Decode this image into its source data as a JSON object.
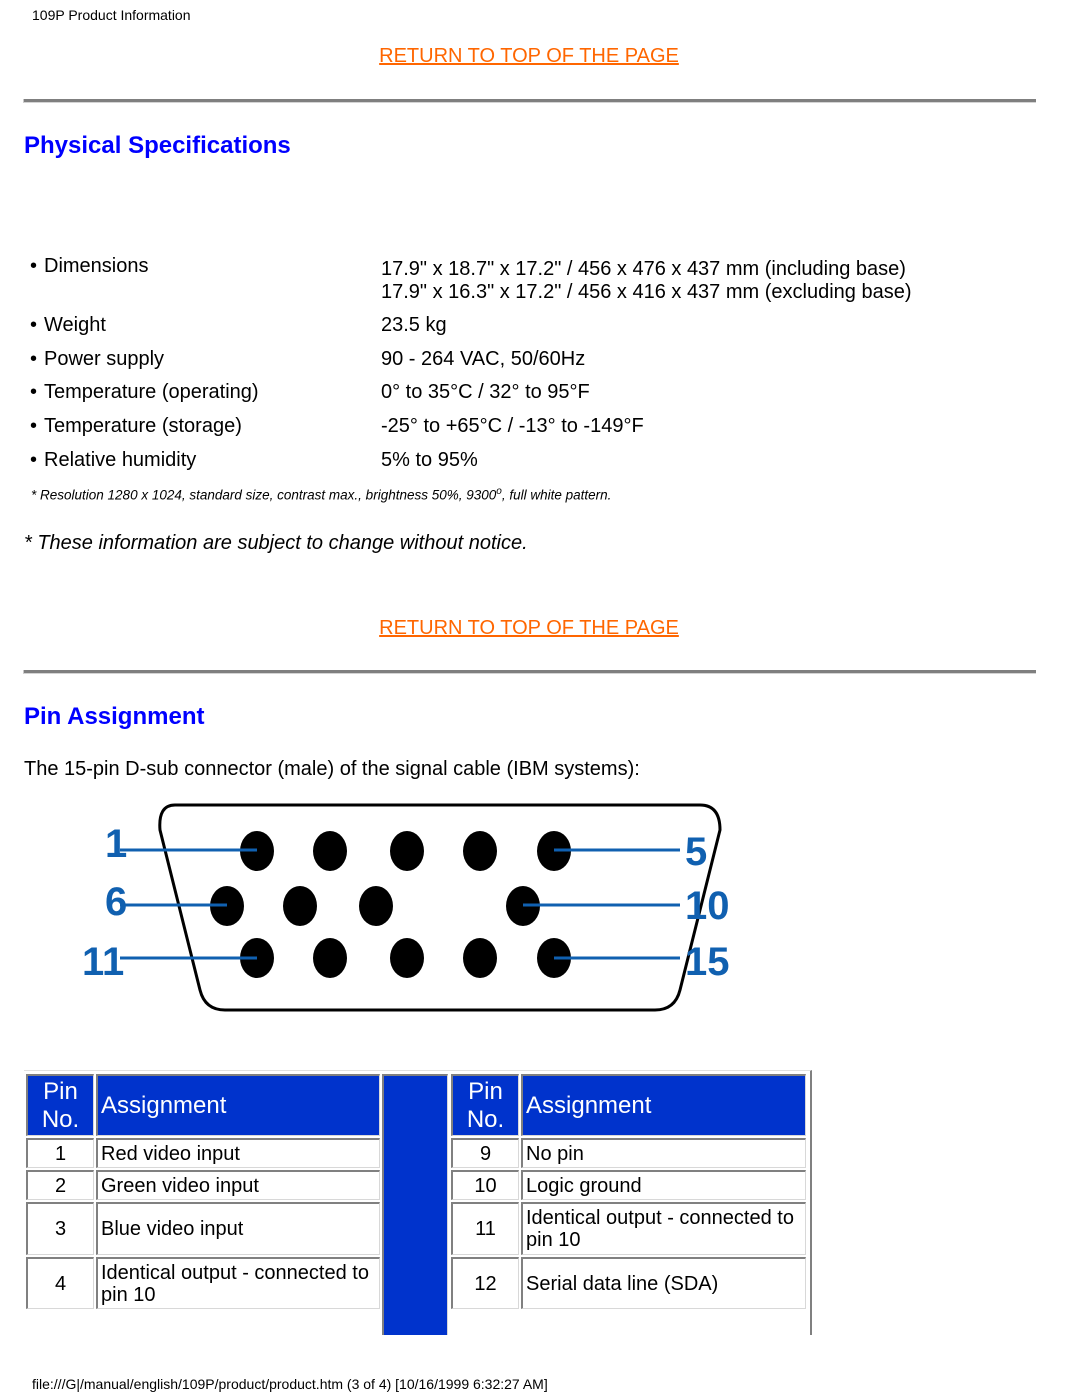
{
  "page": {
    "header": "109P Product Information",
    "footer": "file:///G|/manual/english/109P/product/product.htm (3 of 4) [10/16/1999 6:32:27 AM]",
    "link_color": "#ff6600",
    "heading_color": "#0000ff",
    "table_header_color": "#0033cc"
  },
  "return_link": "RETURN TO TOP OF THE PAGE",
  "physical_specs": {
    "title": "Physical Specifications",
    "bullet": "•",
    "items": [
      {
        "label": "Dimensions",
        "values": [
          "17.9\" x 18.7\" x 17.2\" / 456 x 476 x 437 mm (including base)",
          "17.9\" x 16.3\" x 17.2\" / 456 x 416 x 437 mm (excluding base)"
        ]
      },
      {
        "label": "Weight",
        "values": [
          "23.5 kg"
        ]
      },
      {
        "label": "Power supply",
        "values": [
          "90 - 264 VAC, 50/60Hz"
        ]
      },
      {
        "label": "Temperature (operating)",
        "values": [
          "0° to 35°C / 32° to 95°F"
        ]
      },
      {
        "label": "Temperature (storage)",
        "values": [
          "-25° to +65°C / -13° to -149°F"
        ]
      },
      {
        "label": "Relative humidity",
        "values": [
          "5% to 95%"
        ]
      }
    ],
    "footnote_main": "* Resolution 1280 x 1024, standard size, contrast max., brightness 50%, 9300",
    "footnote_degree": "o",
    "footnote_tail": ", full white pattern.",
    "notice": "* These information are subject to change without notice."
  },
  "pin_assignment": {
    "title": "Pin Assignment",
    "intro": "The 15-pin D-sub connector (male) of the signal cable (IBM systems):",
    "diagram": {
      "labels": [
        "1",
        "5",
        "6",
        "10",
        "11",
        "15"
      ],
      "label_color": "#1060b0"
    },
    "table": {
      "headers": {
        "pin_line1": "Pin",
        "pin_line2": "No.",
        "assignment": "Assignment"
      },
      "left": [
        {
          "pin": "1",
          "assignment": "Red video input"
        },
        {
          "pin": "2",
          "assignment": "Green video input"
        },
        {
          "pin": "3",
          "assignment": "Blue video input"
        },
        {
          "pin": "4",
          "assignment": "Identical output - connected to pin 10"
        }
      ],
      "right": [
        {
          "pin": "9",
          "assignment": "No pin"
        },
        {
          "pin": "10",
          "assignment": "Logic ground"
        },
        {
          "pin": "11",
          "assignment": "Identical output - connected to pin 10"
        },
        {
          "pin": "12",
          "assignment": "Serial data line (SDA)"
        }
      ]
    }
  }
}
